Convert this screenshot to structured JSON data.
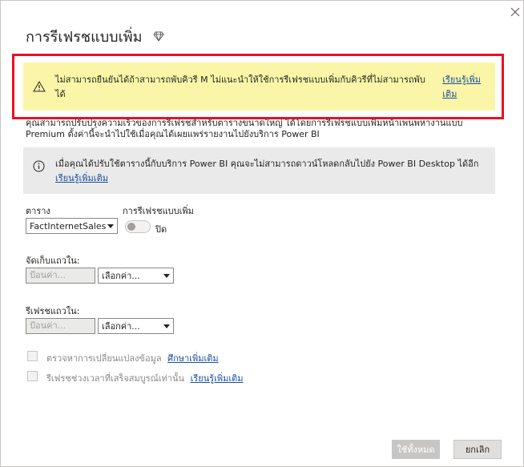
{
  "dialog": {
    "title": "การรีเฟรชแบบเพิ่ม",
    "description": "คุณสามารถปรับปรุงความเร็วของการรีเฟรชสำหรับตารางขนาดใหญ่ ได้โดยการรีเฟรชแบบเพิ่มหน้าเพนพหางานแบบ Premium ตั้งค่านี้จะนำไปใช้เมื่อคุณได้เผยแพร่รายงานไปยังบริการ Power BI"
  },
  "warning": {
    "text": "ไม่สามารถยืนยันได้ถ้าสามารถพับคิวรี M ไม่แนะนำให้ใช้การรีเฟรชแบบเพิ่มกับคิวรีที่ไม่สามารถพับได้",
    "link": "เรียนรู้เพิ่มเติม"
  },
  "info": {
    "text": "เมื่อคุณได้ปรับใช้ตารางนี้กับบริการ Power BI คุณจะไม่สามารถดาวน์โหลดกลับไปยัง Power BI Desktop ได้อีก",
    "link": "เรียนรู้เพิ่มเติม"
  },
  "table": {
    "label": "ตาราง",
    "value": "FactInternetSales"
  },
  "incremental": {
    "label": "การรีเฟรชแบบเพิ่ม",
    "toggle_state": "ปิด"
  },
  "store_rows": {
    "label": "จัดเก็บแถวใน:",
    "input_placeholder": "ป้อนค่า...",
    "select_value": "เลือกค่า..."
  },
  "refresh_rows": {
    "label": "รีเฟรชแถวใน:",
    "input_placeholder": "ป้อนค่า...",
    "select_value": "เลือกค่า..."
  },
  "options": {
    "detect_changes": "ตรวจหาการเปลี่ยนแปลงข้อมูล",
    "detect_link": "ศึกษาเพิ่มเติม",
    "complete_periods": "รีเฟรชช่วงเวลาที่เสร็จสมบูรณ์เท่านั้น",
    "complete_link": "เรียนรู้เพิ่มเติม"
  },
  "buttons": {
    "apply": "ใช้ทั้งหมด",
    "cancel": "ยกเลิก"
  },
  "colors": {
    "warning_bg": "#fbf6a7",
    "highlight_border": "#e81123",
    "link": "#1b4ea0"
  }
}
